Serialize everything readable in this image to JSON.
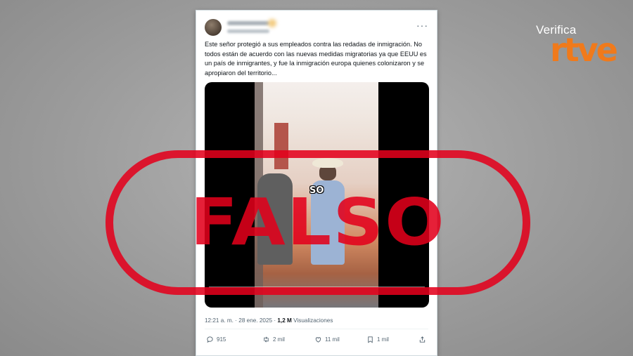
{
  "tweet": {
    "text": "Este señor protegió a sus empleados contra las redadas de inmigración. No todos están de acuerdo con las nuevas medidas migratorias ya que EEUU es un país de inmigrantes, y fue la inmigración europa quienes colonizaron y se apropiaron del territorio...",
    "video_caption": "SO",
    "time": "12:21 a. m.",
    "separator": "·",
    "date": "28 ene. 2025",
    "views_value": "1,2 M",
    "views_label": "Visualizaciones",
    "actions": {
      "replies": "915",
      "reposts": "2 mil",
      "likes": "11 mil",
      "bookmarks": "1 mil"
    }
  },
  "stamp": {
    "text": "FALSO",
    "color": "#e3001b"
  },
  "logo": {
    "top": "Verifica",
    "brand": "rtve",
    "color": "#f07a1b"
  },
  "icons": [
    "more-icon",
    "reply-icon",
    "repost-icon",
    "like-icon",
    "bookmark-icon",
    "share-icon"
  ]
}
